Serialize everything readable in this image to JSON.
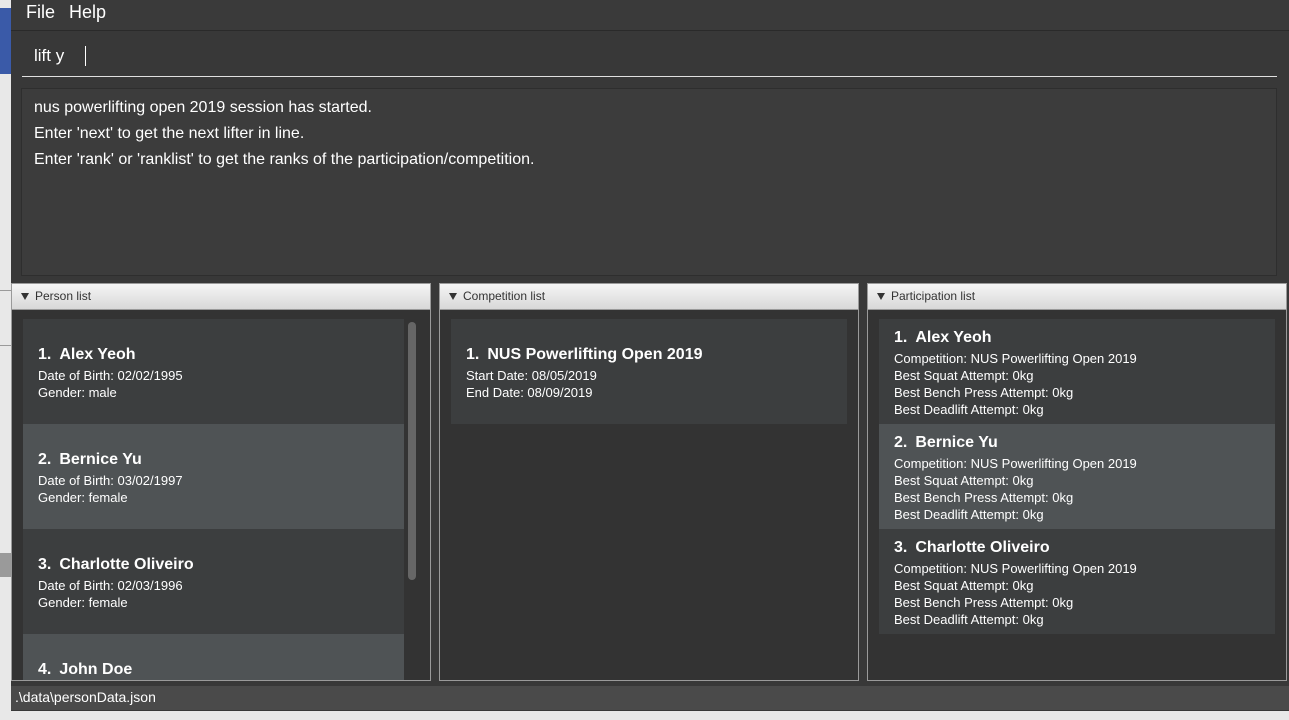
{
  "menu": {
    "file": "File",
    "help": "Help"
  },
  "command": {
    "value": "lift y"
  },
  "result": {
    "lines": [
      "nus powerlifting open 2019 session has started.",
      "Enter 'next' to get the next lifter in line.",
      "Enter 'rank' or 'ranklist' to get the ranks of the participation/competition."
    ]
  },
  "person_panel": {
    "title": "Person list",
    "items": [
      {
        "index": "1.",
        "name": "Alex Yeoh",
        "dob": "Date of Birth: 02/02/1995",
        "gender": "Gender: male"
      },
      {
        "index": "2.",
        "name": "Bernice Yu",
        "dob": "Date of Birth: 03/02/1997",
        "gender": "Gender: female"
      },
      {
        "index": "3.",
        "name": "Charlotte Oliveiro",
        "dob": "Date of Birth: 02/03/1996",
        "gender": "Gender: female"
      },
      {
        "index": "4.",
        "name": "John Doe"
      }
    ]
  },
  "competition_panel": {
    "title": "Competition list",
    "items": [
      {
        "index": "1.",
        "name": "NUS Powerlifting Open 2019",
        "start": "Start Date: 08/05/2019",
        "end": "End Date: 08/09/2019"
      }
    ]
  },
  "participation_panel": {
    "title": "Participation list",
    "items": [
      {
        "index": "1.",
        "name": "Alex Yeoh",
        "competition": "Competition: NUS Powerlifting Open 2019",
        "squat": "Best Squat Attempt: 0kg",
        "bench": "Best Bench Press Attempt: 0kg",
        "deadlift": "Best Deadlift Attempt: 0kg"
      },
      {
        "index": "2.",
        "name": "Bernice Yu",
        "competition": "Competition: NUS Powerlifting Open 2019",
        "squat": "Best Squat Attempt: 0kg",
        "bench": "Best Bench Press Attempt: 0kg",
        "deadlift": "Best Deadlift Attempt: 0kg"
      },
      {
        "index": "3.",
        "name": "Charlotte Oliveiro",
        "competition": "Competition: NUS Powerlifting Open 2019",
        "squat": "Best Squat Attempt: 0kg",
        "bench": "Best Bench Press Attempt: 0kg",
        "deadlift": "Best Deadlift Attempt: 0kg"
      }
    ]
  },
  "status": {
    "path": ".\\data\\personData.json"
  }
}
